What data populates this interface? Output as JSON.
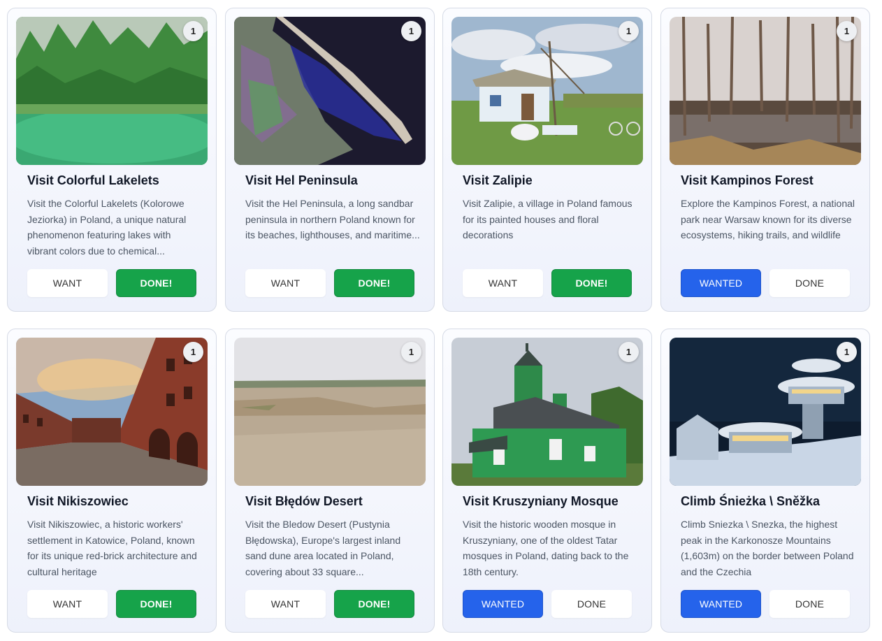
{
  "cards": [
    {
      "badge": "1",
      "title": "Visit Colorful Lakelets",
      "description": "Visit the Colorful Lakelets (Kolorowe Jeziorka) in Poland, a unique natural phenomenon featuring lakes with vibrant colors due to chemical...",
      "want_label": "WANT",
      "done_label": "DONE!",
      "state": "done"
    },
    {
      "badge": "1",
      "title": "Visit Hel Peninsula",
      "description": "Visit the Hel Peninsula, a long sandbar peninsula in northern Poland known for its beaches, lighthouses, and maritime...",
      "want_label": "WANT",
      "done_label": "DONE!",
      "state": "done"
    },
    {
      "badge": "1",
      "title": "Visit Zalipie",
      "description": "Visit Zalipie, a village in Poland famous for its painted houses and floral decorations",
      "want_label": "WANT",
      "done_label": "DONE!",
      "state": "done"
    },
    {
      "badge": "1",
      "title": "Visit Kampinos Forest",
      "description": "Explore the Kampinos Forest, a national park near Warsaw known for its diverse ecosystems, hiking trails, and wildlife",
      "want_label": "WANTED",
      "done_label": "DONE",
      "state": "wanted"
    },
    {
      "badge": "1",
      "title": "Visit Nikiszowiec",
      "description": "Visit Nikiszowiec, a historic workers' settlement in Katowice, Poland, known for its unique red-brick architecture and cultural heritage",
      "want_label": "WANT",
      "done_label": "DONE!",
      "state": "done"
    },
    {
      "badge": "1",
      "title": "Visit Błędów Desert",
      "description": "Visit the Bledow Desert (Pustynia Błędowska), Europe's largest inland sand dune area located in Poland, covering about 33 square...",
      "want_label": "WANT",
      "done_label": "DONE!",
      "state": "done"
    },
    {
      "badge": "1",
      "title": "Visit Kruszyniany Mosque",
      "description": "Visit the historic wooden mosque in Kruszyniany, one of the oldest Tatar mosques in Poland, dating back to the 18th century.",
      "want_label": "WANTED",
      "done_label": "DONE",
      "state": "wanted"
    },
    {
      "badge": "1",
      "title": "Climb Śnieżka \\ Sněžka",
      "description": "Climb Sniezka \\ Snezka, the highest peak in the Karkonosze Mountains (1,603m) on the border between Poland and the Czechia",
      "want_label": "WANTED",
      "done_label": "DONE",
      "state": "wanted"
    }
  ],
  "colors": {
    "done_green": "#16a34a",
    "wanted_blue": "#2563eb"
  }
}
